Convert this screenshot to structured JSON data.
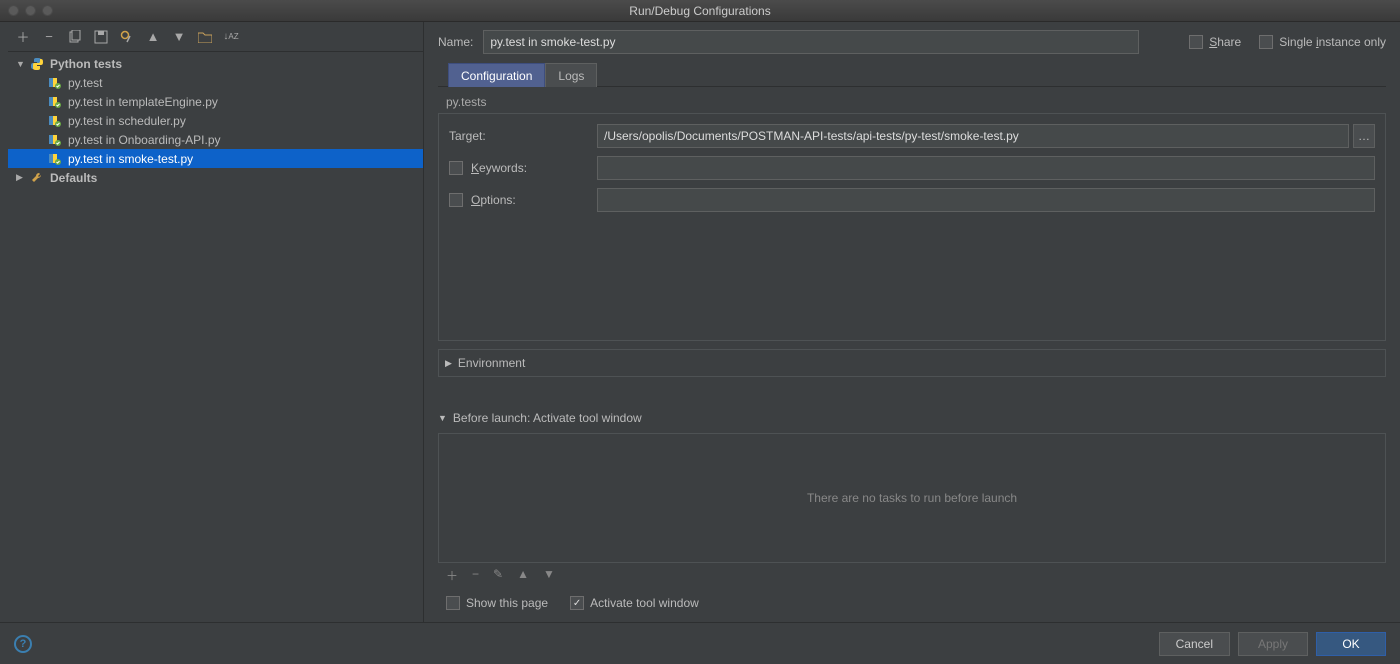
{
  "window": {
    "title": "Run/Debug Configurations"
  },
  "sidebar": {
    "root": {
      "label": "Python tests"
    },
    "items": [
      {
        "label": "py.test"
      },
      {
        "label": "py.test in templateEngine.py"
      },
      {
        "label": "py.test in scheduler.py"
      },
      {
        "label": "py.test in Onboarding-API.py"
      },
      {
        "label": "py.test in smoke-test.py"
      }
    ],
    "defaults": {
      "label": "Defaults"
    }
  },
  "form": {
    "name_label": "Name:",
    "name_value": "py.test in smoke-test.py",
    "share_label": "Share",
    "single_instance_label": "Single instance only",
    "tabs": {
      "configuration": "Configuration",
      "logs": "Logs"
    },
    "group_title": "py.tests",
    "target_label": "Target:",
    "target_value": "/Users/opolis/Documents/POSTMAN-API-tests/api-tests/py-test/smoke-test.py",
    "keywords_label": "Keywords:",
    "options_label": "Options:",
    "environment_label": "Environment",
    "before_launch_label": "Before launch: Activate tool window",
    "empty_tasks": "There are no tasks to run before launch",
    "show_page_label": "Show this page",
    "activate_tool_label": "Activate tool window"
  },
  "footer": {
    "cancel": "Cancel",
    "apply": "Apply",
    "ok": "OK"
  }
}
